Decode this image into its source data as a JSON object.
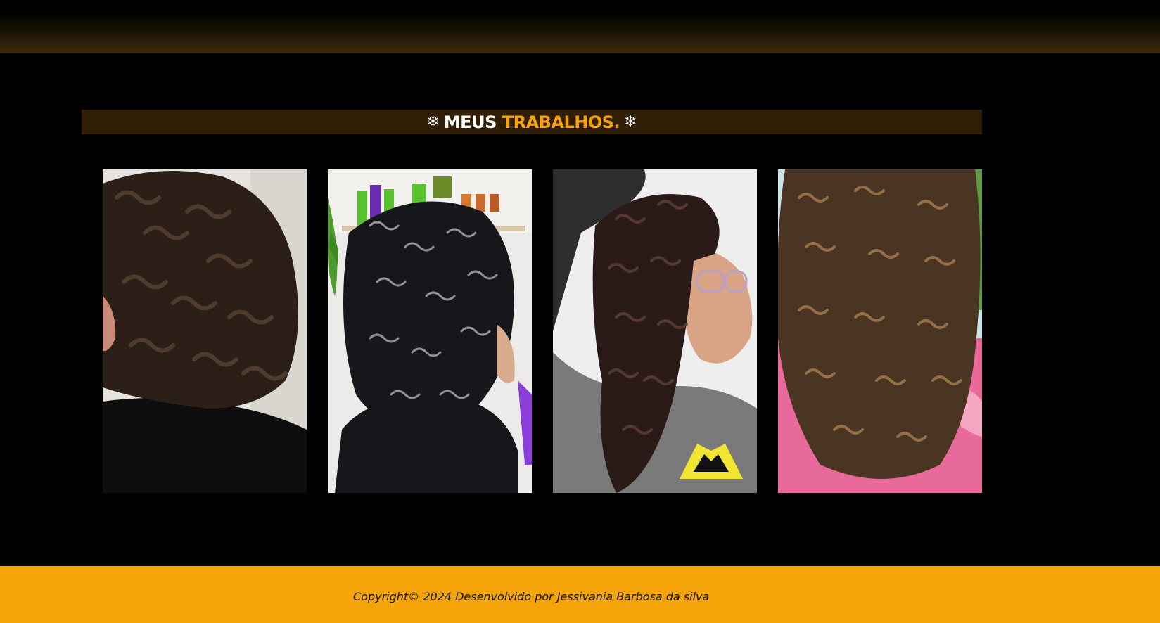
{
  "section": {
    "title_main": "MEUS",
    "title_accent": "TRABALHOS.",
    "ornament": "❄",
    "accent_color": "#f4a30a",
    "band_color": "#2f1e03"
  },
  "gallery": {
    "photos": [
      {
        "name": "photo-curly-hair-1",
        "description": ""
      },
      {
        "name": "photo-curly-hair-2",
        "description": ""
      },
      {
        "name": "photo-curly-hair-3",
        "description": ""
      },
      {
        "name": "photo-curly-hair-4",
        "description": ""
      }
    ]
  },
  "footer": {
    "copyright": "Copyright© 2024 Desenvolvido por Jessivania Barbosa da silva",
    "background_color": "#f4a409"
  }
}
